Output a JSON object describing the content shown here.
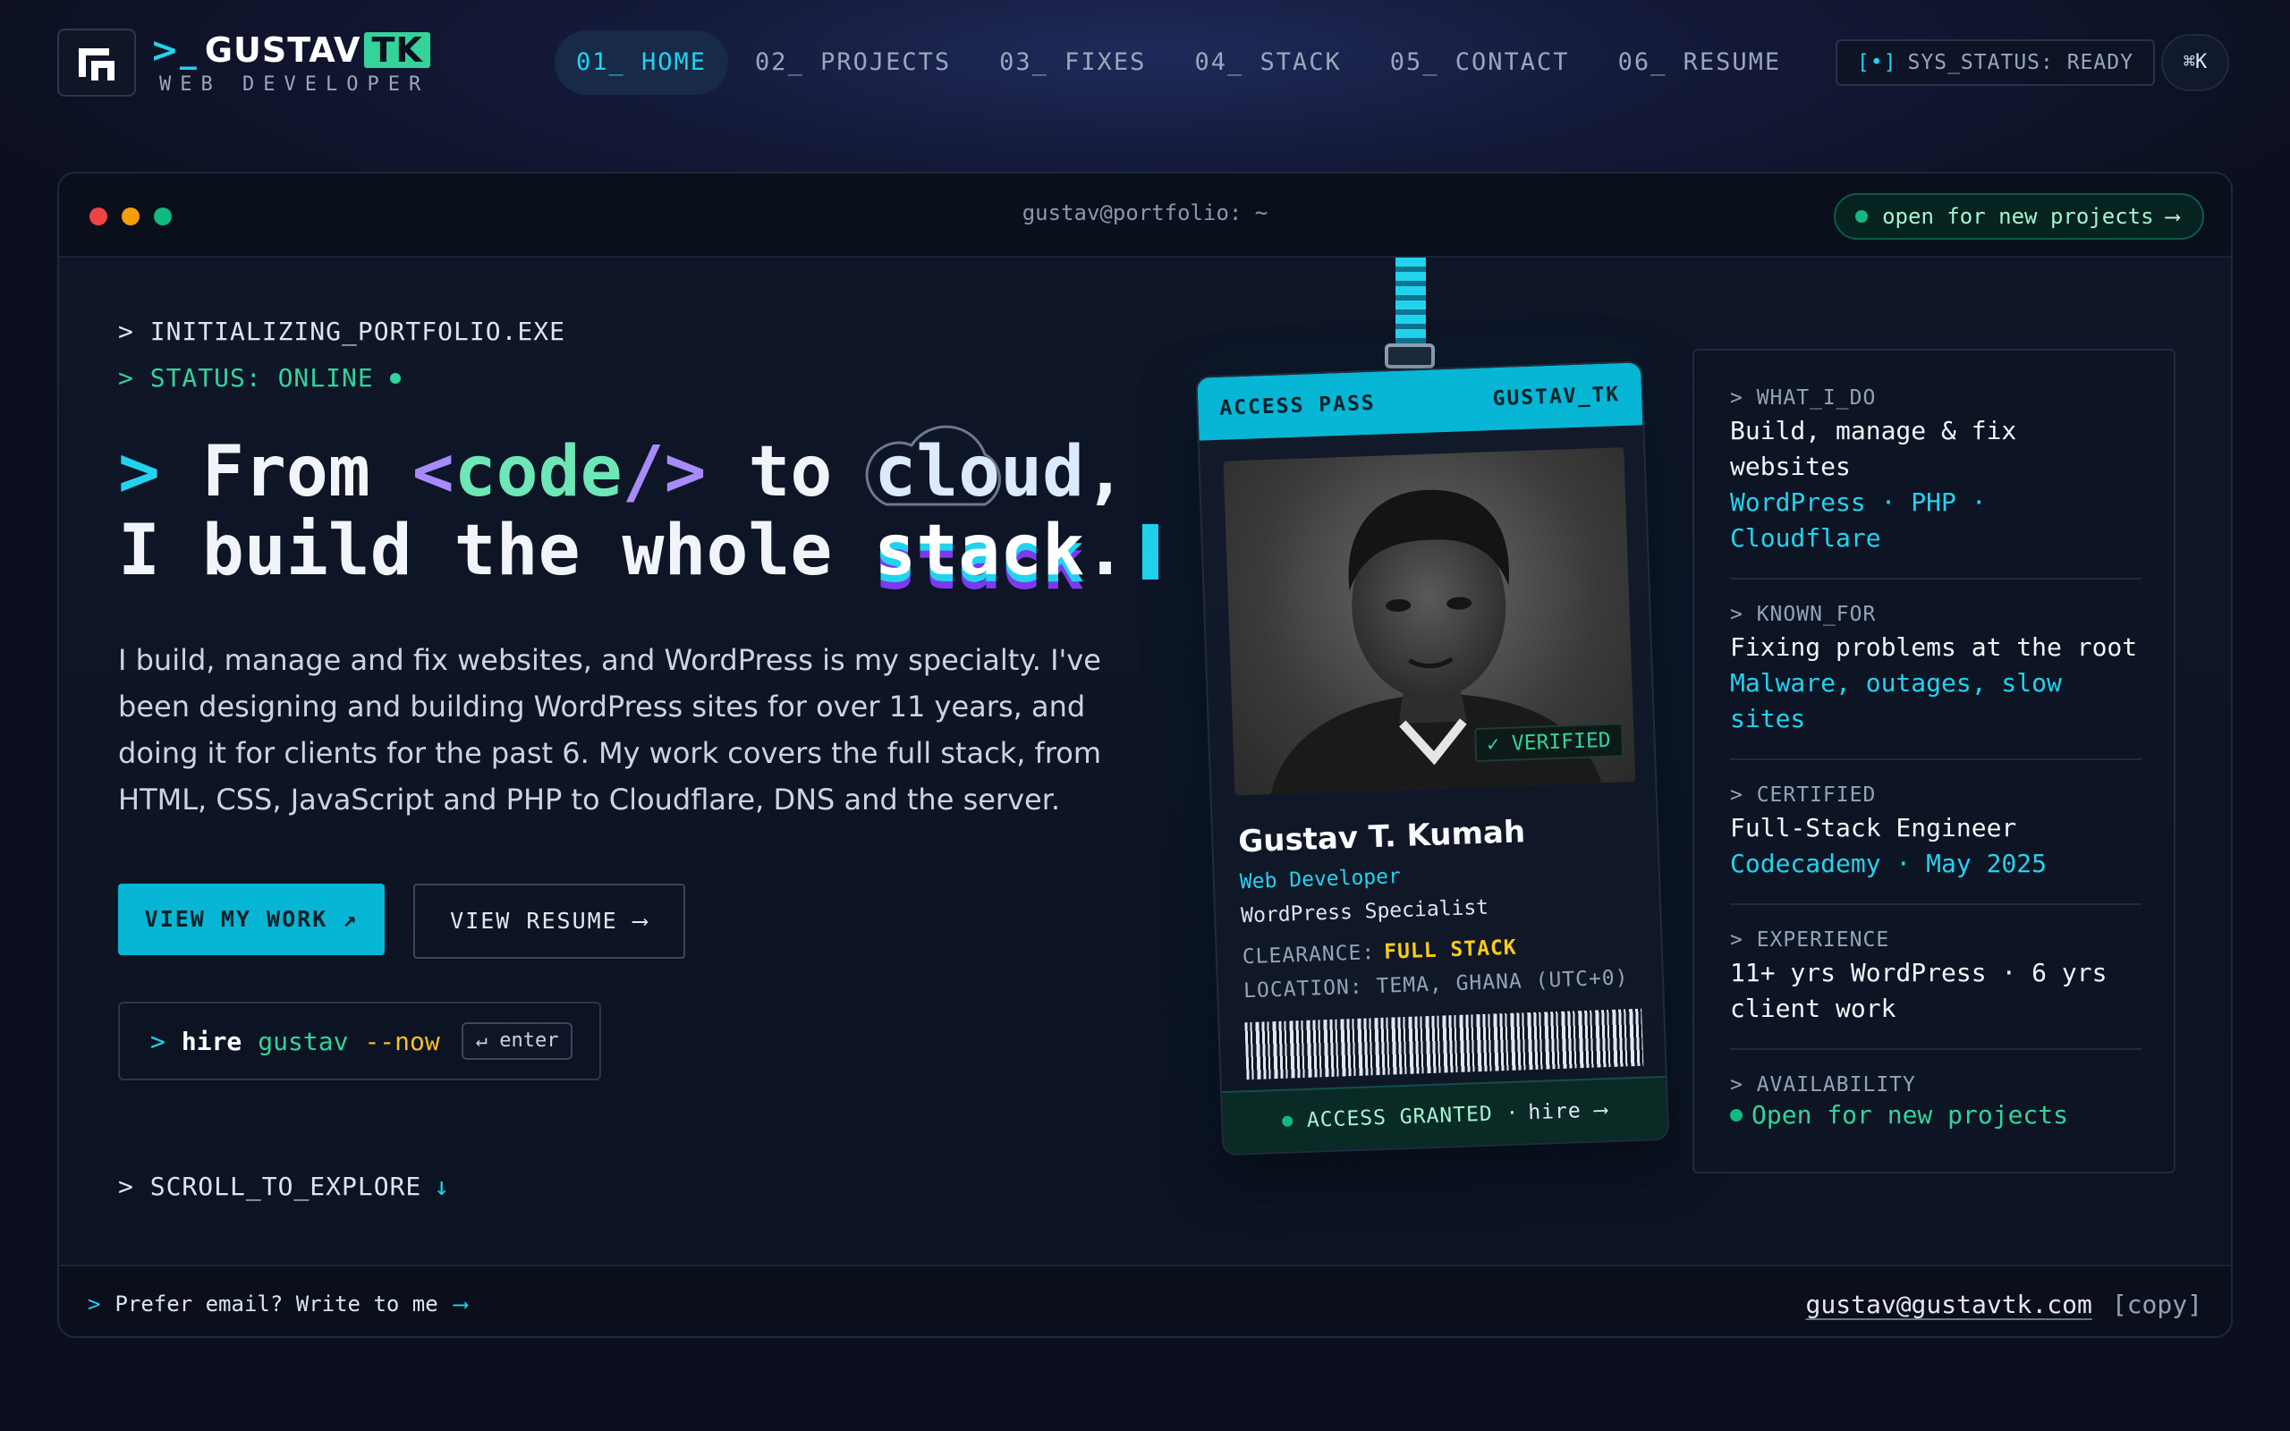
{
  "nav": {
    "brand_prompt": ">_",
    "brand_name": "GUSTAV",
    "brand_tk": "TK",
    "brand_sub": "WEB DEVELOPER",
    "links": [
      {
        "label": "01_ HOME"
      },
      {
        "label": "02_ PROJECTS"
      },
      {
        "label": "03_ FIXES"
      },
      {
        "label": "04_ STACK"
      },
      {
        "label": "05_ CONTACT"
      },
      {
        "label": "06_ RESUME"
      }
    ],
    "sys_status_bracket": "[•]",
    "sys_status": "SYS_STATUS: READY",
    "kbar": "⌘K"
  },
  "window": {
    "title": "gustav@portfolio: ~",
    "open_pill": "open for new projects",
    "open_arrow": "⟶"
  },
  "hero": {
    "init_line": "> INITIALIZING_PORTFOLIO.EXE",
    "status_line": "> STATUS: ONLINE",
    "headline": {
      "prompt": ">",
      "from": "From",
      "code_open": "<",
      "code_word": "code",
      "code_close": "/>",
      "to": "to",
      "cloud": "cloud",
      "comma": ",",
      "line2_a": "I build the whole",
      "stack": "stack",
      "period": "."
    },
    "bio": "I build, manage and fix websites, and WordPress is my specialty. I've been designing and building WordPress sites for over 11 years, and doing it for clients for the past 6. My work covers the full stack, from HTML, CSS, JavaScript and PHP to Cloudflare, DNS and the server.",
    "btn_work": "VIEW MY WORK ↗",
    "btn_resume": "VIEW RESUME ⟶",
    "hire": {
      "prompt": ">",
      "w1": "hire",
      "w2": "gustav",
      "w3": "--now",
      "key": "↵ enter"
    },
    "scroll": "> SCROLL_TO_EXPLORE",
    "scroll_arrow": "↓"
  },
  "footer": {
    "prompt": ">",
    "text": "Prefer email? Write to me",
    "arrow": "⟶",
    "email": "gustav@gustavtk.com",
    "copy": "[copy]"
  },
  "badge": {
    "head_left": "ACCESS PASS",
    "head_right": "GUSTAV_TK",
    "verified": "✓ VERIFIED",
    "name": "Gustav T. Kumah",
    "role": "Web Developer",
    "spec": "WordPress Specialist",
    "clearance_label": "CLEARANCE:",
    "clearance_value": "FULL STACK",
    "location": "LOCATION: TEMA, GHANA (UTC+0)",
    "footer_text": "ACCESS GRANTED · ",
    "footer_hire": "hire ⟶"
  },
  "info": [
    {
      "label": "> WHAT_I_DO",
      "value": "Build, manage & fix websites",
      "sub": "WordPress · PHP · Cloudflare"
    },
    {
      "label": "> KNOWN_FOR",
      "value": "Fixing problems at the root",
      "sub": "Malware, outages, slow sites"
    },
    {
      "label": "> CERTIFIED",
      "value": "Full-Stack Engineer",
      "sub": "Codecademy · May 2025"
    },
    {
      "label": "> EXPERIENCE",
      "value": "11+ yrs WordPress · 6 yrs client work"
    },
    {
      "label": "> AVAILABILITY",
      "value": "Open for new projects"
    }
  ],
  "colors": {
    "accent": "#22d3ee",
    "green": "#34d399",
    "purple": "#a78bfa",
    "yellow": "#facc15"
  }
}
